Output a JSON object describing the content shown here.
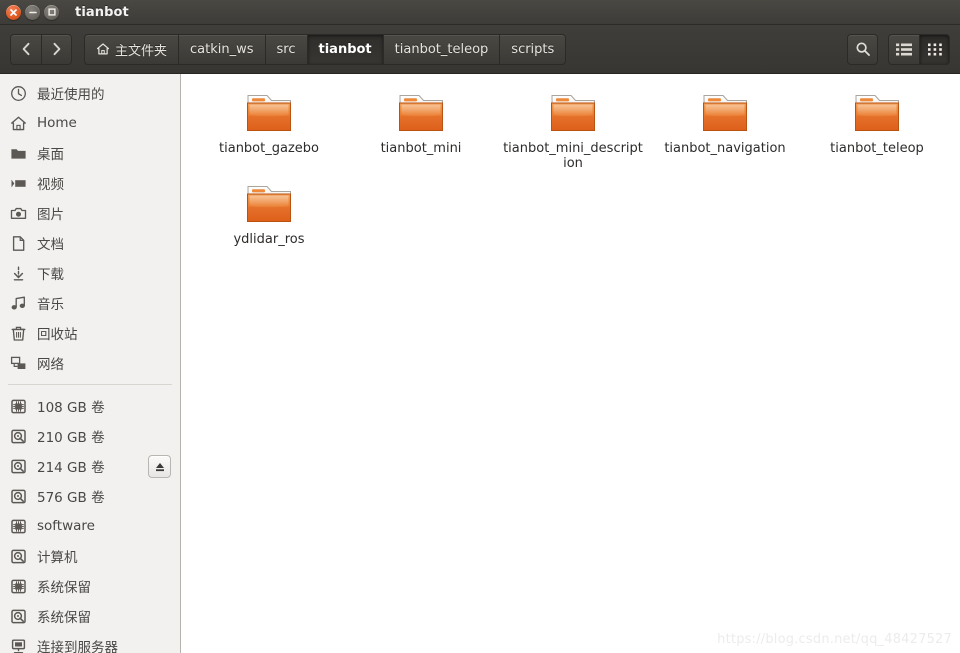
{
  "window": {
    "title": "tianbot",
    "controls": [
      {
        "name": "close",
        "glyph": "×"
      },
      {
        "name": "minimize",
        "glyph": "−"
      },
      {
        "name": "maximize",
        "glyph": "□"
      }
    ]
  },
  "toolbar": {
    "back_label": "‹",
    "forward_label": "›",
    "breadcrumbs": [
      {
        "label": "主文件夹",
        "icon": "home-icon",
        "active": false
      },
      {
        "label": "catkin_ws",
        "icon": "",
        "active": false
      },
      {
        "label": "src",
        "icon": "",
        "active": false
      },
      {
        "label": "tianbot",
        "icon": "",
        "active": true
      },
      {
        "label": "tianbot_teleop",
        "icon": "",
        "active": false
      },
      {
        "label": "scripts",
        "icon": "",
        "active": false
      }
    ],
    "search_label": "search-icon",
    "list_view_label": "list-view-icon",
    "grid_view_label": "grid-view-icon",
    "active_view": "grid"
  },
  "sidebar": {
    "groups": [
      {
        "items": [
          {
            "label": "最近使用的",
            "icon": "clock-icon"
          },
          {
            "label": "Home",
            "icon": "home-icon"
          },
          {
            "label": "桌面",
            "icon": "folder-icon"
          },
          {
            "label": "视频",
            "icon": "video-icon"
          },
          {
            "label": "图片",
            "icon": "camera-icon"
          },
          {
            "label": "文档",
            "icon": "document-icon"
          },
          {
            "label": "下载",
            "icon": "download-icon"
          },
          {
            "label": "音乐",
            "icon": "music-icon"
          },
          {
            "label": "回收站",
            "icon": "trash-icon"
          },
          {
            "label": "网络",
            "icon": "network-icon"
          }
        ]
      },
      {
        "items": [
          {
            "label": "108 GB 卷",
            "icon": "ssd-icon",
            "eject": false
          },
          {
            "label": "210 GB 卷",
            "icon": "harddisk-icon",
            "eject": false
          },
          {
            "label": "214 GB 卷",
            "icon": "harddisk-icon",
            "eject": true
          },
          {
            "label": "576 GB 卷",
            "icon": "harddisk-icon",
            "eject": false
          },
          {
            "label": "software",
            "icon": "ssd-icon",
            "eject": false
          },
          {
            "label": "计算机",
            "icon": "harddisk-icon",
            "eject": false
          },
          {
            "label": "系统保留",
            "icon": "ssd-icon",
            "eject": false
          },
          {
            "label": "系统保留",
            "icon": "harddisk-icon",
            "eject": false
          },
          {
            "label": "连接到服务器",
            "icon": "server-icon",
            "eject": false
          }
        ]
      }
    ]
  },
  "main": {
    "files": [
      {
        "name": "tianbot_gazebo",
        "type": "folder"
      },
      {
        "name": "tianbot_mini",
        "type": "folder"
      },
      {
        "name": "tianbot_mini_description",
        "type": "folder"
      },
      {
        "name": "tianbot_navigation",
        "type": "folder"
      },
      {
        "name": "tianbot_teleop",
        "type": "folder"
      },
      {
        "name": "ydlidar_ros",
        "type": "folder"
      }
    ]
  },
  "watermark": {
    "text": "https://blog.csdn.net/qq_48427527"
  },
  "colors": {
    "titlebar": "#3e3c38",
    "toolbar": "#3a3834",
    "sidebar": "#f2f1f0",
    "content": "#ffffff",
    "folder_orange": "#e8762a",
    "close_button": "#e25c26"
  }
}
